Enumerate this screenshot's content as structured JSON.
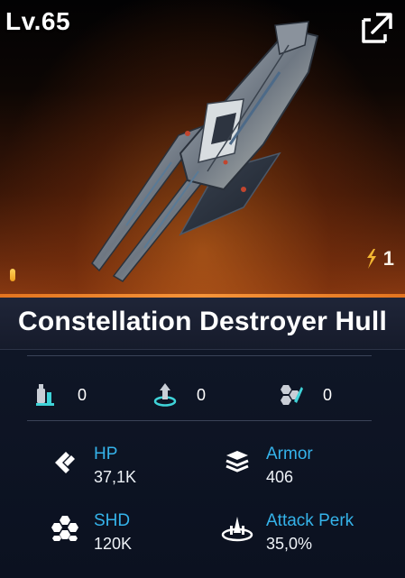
{
  "header": {
    "level": "Lv.65",
    "count": "1"
  },
  "item": {
    "name": "Constellation Destroyer Hull"
  },
  "mini_stats": [
    {
      "icon": "module-icon",
      "value": "0"
    },
    {
      "icon": "deploy-icon",
      "value": "0"
    },
    {
      "icon": "cluster-icon",
      "value": "0"
    }
  ],
  "stats": {
    "hp": {
      "label": "HP",
      "value": "37,1K"
    },
    "armor": {
      "label": "Armor",
      "value": "406"
    },
    "shd": {
      "label": "SHD",
      "value": "120K"
    },
    "attack_perk": {
      "label": "Attack Perk",
      "value": "35,0%"
    }
  },
  "colors": {
    "accent_orange": "#f7953a",
    "label_blue": "#35b3ea",
    "icon_cyan": "#3fd3d8"
  }
}
